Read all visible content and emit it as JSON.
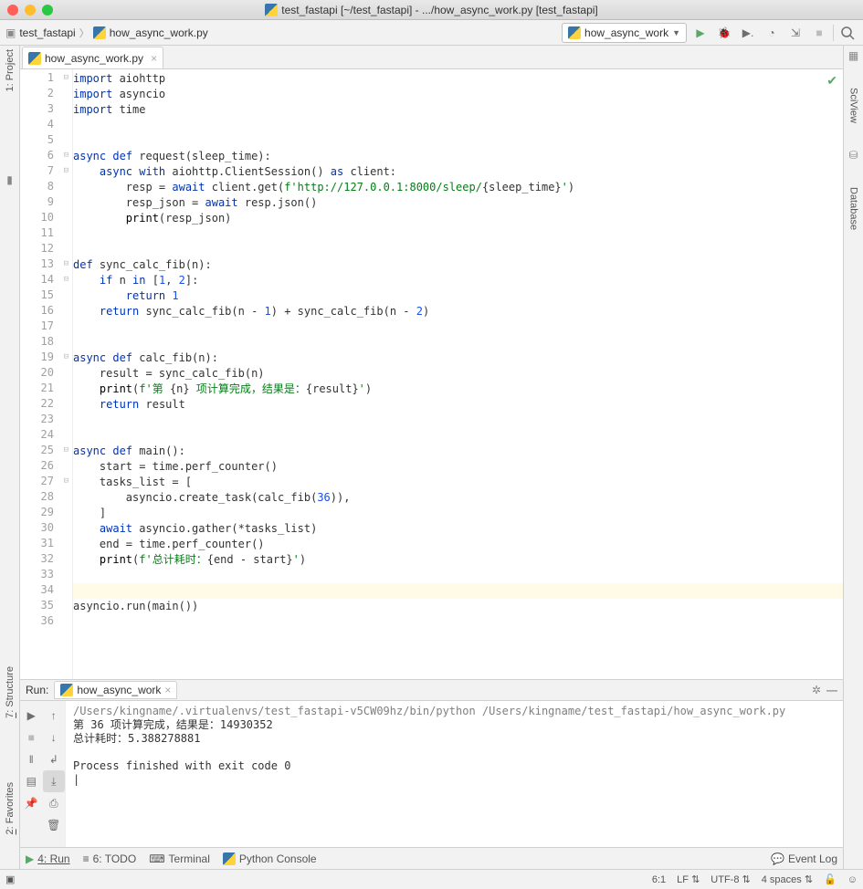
{
  "window": {
    "title": "test_fastapi [~/test_fastapi] - .../how_async_work.py [test_fastapi]"
  },
  "breadcrumb": {
    "project": "test_fastapi",
    "file": "how_async_work.py"
  },
  "runconfig": {
    "selected": "how_async_work"
  },
  "left_tools": {
    "project": "1: Project"
  },
  "right_tools": {
    "sciview": "SciView",
    "database": "Database"
  },
  "editor_tab": {
    "label": "how_async_work.py"
  },
  "code_lines": [
    {
      "n": 1,
      "fold": "-",
      "html": "<span class='kw'>import</span> aiohttp"
    },
    {
      "n": 2,
      "fold": "",
      "html": "<span class='kw'>import</span> asyncio"
    },
    {
      "n": 3,
      "fold": "",
      "html": "<span class='kw'>import</span> time"
    },
    {
      "n": 4,
      "fold": "",
      "html": ""
    },
    {
      "n": 5,
      "fold": "",
      "html": ""
    },
    {
      "n": 6,
      "fold": "-",
      "html": "<span class='kw'>async def</span> request(sleep_time):"
    },
    {
      "n": 7,
      "fold": "-",
      "html": "    <span class='kw'>async with</span> aiohttp.ClientSession() <span class='kw'>as</span> client:"
    },
    {
      "n": 8,
      "fold": "",
      "html": "        resp = <span class='kw'>await</span> client.get(<span class='str'>f'http://127.0.0.1:8000/sleep/</span>{sleep_time}<span class='str'>'</span>)"
    },
    {
      "n": 9,
      "fold": "",
      "html": "        resp_json = <span class='kw'>await</span> resp.json()"
    },
    {
      "n": 10,
      "fold": "",
      "html": "        <span class='bi'>print</span>(resp_json)"
    },
    {
      "n": 11,
      "fold": "",
      "html": ""
    },
    {
      "n": 12,
      "fold": "",
      "html": ""
    },
    {
      "n": 13,
      "fold": "-",
      "html": "<span class='kw'>def</span> sync_calc_fib(n):"
    },
    {
      "n": 14,
      "fold": "-",
      "html": "    <span class='kw'>if</span> n <span class='kw'>in</span> [<span class='num'>1</span>, <span class='num'>2</span>]:"
    },
    {
      "n": 15,
      "fold": "",
      "html": "        <span class='kw'>return</span> <span class='num'>1</span>"
    },
    {
      "n": 16,
      "fold": "",
      "html": "    <span class='kw'>return</span> sync_calc_fib(n - <span class='num'>1</span>) + sync_calc_fib(n - <span class='num'>2</span>)"
    },
    {
      "n": 17,
      "fold": "",
      "html": ""
    },
    {
      "n": 18,
      "fold": "",
      "html": ""
    },
    {
      "n": 19,
      "fold": "-",
      "html": "<span class='kw'>async def</span> calc_fib(n):"
    },
    {
      "n": 20,
      "fold": "",
      "html": "    result = sync_calc_fib(n)"
    },
    {
      "n": 21,
      "fold": "",
      "html": "    <span class='bi'>print</span>(<span class='str'>f'第 </span>{n}<span class='str'> 项计算完成，结果是：</span>{result}<span class='str'>'</span>)"
    },
    {
      "n": 22,
      "fold": "",
      "html": "    <span class='kw'>return</span> result"
    },
    {
      "n": 23,
      "fold": "",
      "html": ""
    },
    {
      "n": 24,
      "fold": "",
      "html": ""
    },
    {
      "n": 25,
      "fold": "-",
      "html": "<span class='kw'>async def</span> main():"
    },
    {
      "n": 26,
      "fold": "",
      "html": "    start = time.perf_counter()"
    },
    {
      "n": 27,
      "fold": "-",
      "html": "    tasks_list = ["
    },
    {
      "n": 28,
      "fold": "",
      "html": "        asyncio.create_task(calc_fib(<span class='num'>36</span>)),"
    },
    {
      "n": 29,
      "fold": "",
      "html": "    ]"
    },
    {
      "n": 30,
      "fold": "",
      "html": "    <span class='kw'>await</span> asyncio.gather(*tasks_list)"
    },
    {
      "n": 31,
      "fold": "",
      "html": "    end = time.perf_counter()"
    },
    {
      "n": 32,
      "fold": "",
      "html": "    <span class='bi'>print</span>(<span class='str'>f'总计耗时：</span>{end - start}<span class='str'>'</span>)"
    },
    {
      "n": 33,
      "fold": "",
      "html": ""
    },
    {
      "n": 34,
      "fold": "",
      "html": "",
      "hl": true
    },
    {
      "n": 35,
      "fold": "",
      "html": "asyncio.run(main())"
    },
    {
      "n": 36,
      "fold": "",
      "html": ""
    }
  ],
  "run_panel": {
    "title": "Run:",
    "tab": "how_async_work",
    "console": {
      "cmd": "/Users/kingname/.virtualenvs/test_fastapi-v5CW09hz/bin/python /Users/kingname/test_fastapi/how_async_work.py",
      "l1": "第 36 项计算完成，结果是：14930352",
      "l2": "总计耗时：5.388278881",
      "l3": "",
      "l4": "Process finished with exit code 0"
    }
  },
  "bottom": {
    "run": "4: Run",
    "todo": "6: TODO",
    "terminal": "Terminal",
    "pyconsole": "Python Console",
    "eventlog": "Event Log"
  },
  "status": {
    "pos": "6:1",
    "sep": "LF",
    "enc": "UTF-8",
    "indent": "4 spaces"
  }
}
